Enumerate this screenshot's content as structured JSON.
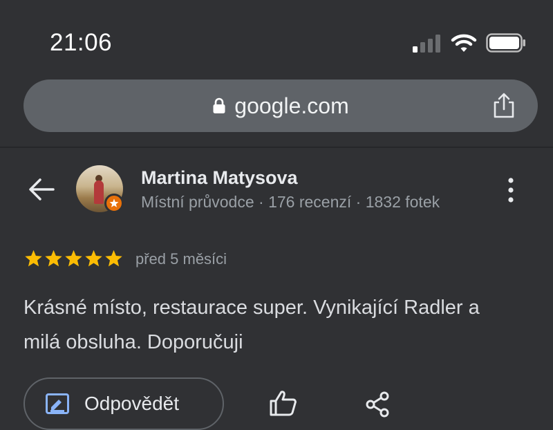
{
  "status_bar": {
    "time": "21:06",
    "icons": [
      "cellular-signal-icon",
      "wifi-icon",
      "battery-icon"
    ]
  },
  "browser": {
    "url": "google.com",
    "icons": [
      "lock-icon",
      "share-icon"
    ]
  },
  "review": {
    "author_name": "Martina Matysova",
    "author_meta": "Místní průvodce · 176 recenzí · 1832 fotek",
    "rating": 5,
    "rating_max": 5,
    "time_ago": "před 5 měsíci",
    "text": "Krásné místo, restaurace super. Vynikající Radler a milá obsluha. Doporučuji"
  },
  "actions": {
    "reply_label": "Odpovědět",
    "icons": [
      "reply-icon",
      "thumbs-up-icon",
      "share-icon"
    ]
  },
  "colors": {
    "background": "#303134",
    "address_bar": "#5f6368",
    "star": "#fbbc04",
    "badge": "#e8710a",
    "reply_icon": "#8ab4f8"
  }
}
